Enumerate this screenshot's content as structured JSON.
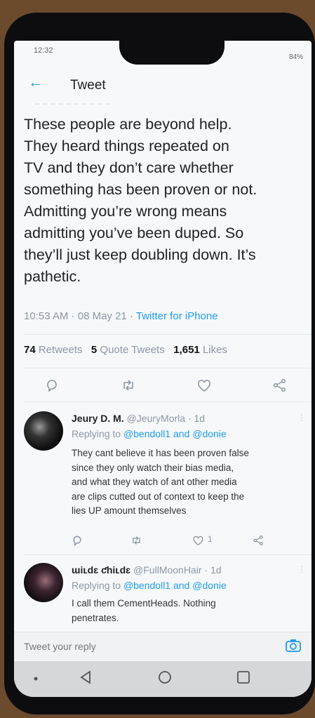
{
  "status": {
    "time": "12:32",
    "battery": "84%"
  },
  "header": {
    "back_label": "←",
    "title": "Tweet"
  },
  "tweet": {
    "lines": [
      "These people are beyond help.",
      "They heard things repeated on",
      "TV and they don’t care whether",
      "something has been proven or not.",
      "Admitting you’re wrong means",
      "admitting you’ve been duped. So",
      "they’ll just keep doubling down. It’s",
      "pathetic."
    ],
    "time": "10:53 AM",
    "date": "08 May 21",
    "source": "Twitter for iPhone",
    "retweets_count": "74",
    "retweets_label": "Retweets",
    "quotes_count": "5",
    "quotes_label": "Quote Tweets",
    "likes_count": "1,651",
    "likes_label": "Likes"
  },
  "replies": [
    {
      "name": "Jeury D. M.",
      "handle": "@JeuryMorla",
      "age": "1d",
      "replying_prefix": "Replying to",
      "mention1": "@bendoll1",
      "and_word": "and",
      "mention2": "@donie",
      "text_lines": [
        "They cant believe it has been proven false",
        "since they only watch their bias media,",
        "and what they watch of ant other media",
        "are clips cutted out of context to keep the",
        "lies UP amount themselves"
      ],
      "like_count": "1"
    },
    {
      "name": "ɯiʟdɛ ƈhiʟdɛ",
      "handle": "@FullMoonHair",
      "age": "1d",
      "replying_prefix": "Replying to",
      "mention1": "@bendoll1",
      "and_word": "and",
      "mention2": "@donie",
      "text_lines": [
        "I call them CementHeads. Nothing",
        "penetrates."
      ]
    }
  ],
  "composer": {
    "placeholder": "Tweet your reply"
  },
  "colors": {
    "accent": "#1d9bf0",
    "muted": "#8b98a5",
    "text": "#222222"
  },
  "icons": [
    "back-arrow-icon",
    "reply-icon",
    "retweet-icon",
    "like-icon",
    "share-icon",
    "camera-icon",
    "nav-back-icon",
    "nav-home-icon",
    "nav-recents-icon"
  ]
}
